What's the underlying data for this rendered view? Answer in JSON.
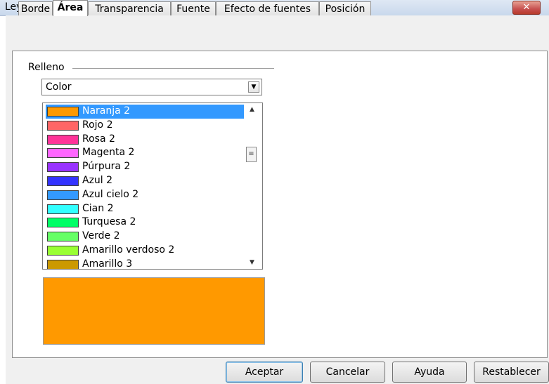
{
  "window": {
    "title": "Leyenda",
    "close_glyph": "✕"
  },
  "tabs": [
    {
      "label": "Borde"
    },
    {
      "label": "Área"
    },
    {
      "label": "Transparencia"
    },
    {
      "label": "Fuente"
    },
    {
      "label": "Efecto de fuentes"
    },
    {
      "label": "Posición"
    }
  ],
  "fill": {
    "group_label": "Relleno",
    "type_value": "Color",
    "colors": [
      {
        "name": "Naranja 2",
        "hex": "#ff9900",
        "selected": true
      },
      {
        "name": "Rojo 2",
        "hex": "#ff6666"
      },
      {
        "name": "Rosa 2",
        "hex": "#ff3399"
      },
      {
        "name": "Magenta 2",
        "hex": "#ff66ff"
      },
      {
        "name": "Púrpura 2",
        "hex": "#9933ff"
      },
      {
        "name": "Azul 2",
        "hex": "#3333ff"
      },
      {
        "name": "Azul cielo 2",
        "hex": "#3399ff"
      },
      {
        "name": "Cian 2",
        "hex": "#33ffff"
      },
      {
        "name": "Turquesa 2",
        "hex": "#00ff66"
      },
      {
        "name": "Verde 2",
        "hex": "#66ff66"
      },
      {
        "name": "Amarillo verdoso 2",
        "hex": "#99ff33"
      },
      {
        "name": "Amarillo 3",
        "hex": "#cc9900"
      }
    ],
    "preview_color": "#ff9900"
  },
  "buttons": {
    "ok": "Aceptar",
    "cancel": "Cancelar",
    "help": "Ayuda",
    "reset": "Restablecer"
  }
}
